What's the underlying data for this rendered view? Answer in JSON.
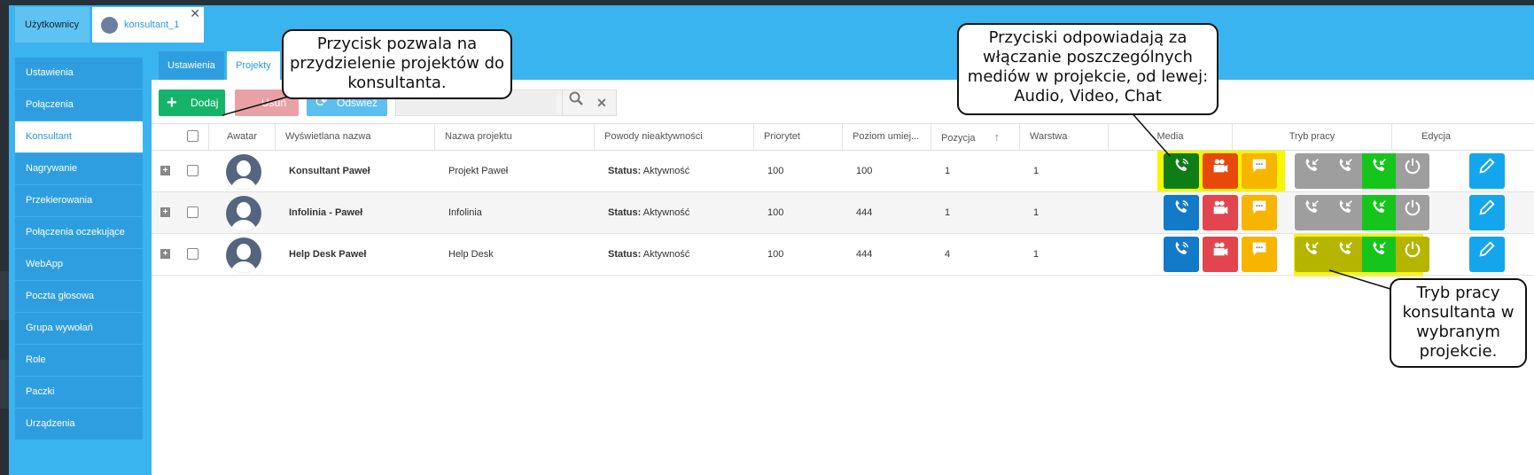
{
  "top_tabs": {
    "users": "Użytkownicy",
    "user": "konsultant_1",
    "close": "✕"
  },
  "sidebar": {
    "items": [
      {
        "label": "Ustawienia"
      },
      {
        "label": "Połączenia"
      },
      {
        "label": "Konsultant",
        "active": true
      },
      {
        "label": "Nagrywanie"
      },
      {
        "label": "Przekierowania"
      },
      {
        "label": "Połączenia oczekujące"
      },
      {
        "label": "WebApp"
      },
      {
        "label": "Poczta głosowa"
      },
      {
        "label": "Grupa wywołań"
      },
      {
        "label": "Role"
      },
      {
        "label": "Paczki"
      },
      {
        "label": "Urządzenia"
      }
    ]
  },
  "content_tabs": [
    "Ustawienia",
    "Projekty"
  ],
  "toolbar": {
    "add": "Dodaj",
    "delete": "Usuń",
    "refresh": "Odśwież",
    "search_placeholder": ""
  },
  "table": {
    "columns": [
      "Awatar",
      "Wyświetlana nazwa",
      "Nazwa projektu",
      "Powody nieaktywności",
      "Priorytet",
      "Poziom umiej...",
      "Pozycja",
      "Warstwa",
      "Media",
      "Tryb pracy",
      "Edycja"
    ],
    "sort_indicator": "↑",
    "rows": [
      {
        "name": "Konsultant Paweł",
        "project": "Projekt Paweł",
        "status_label": "Status:",
        "status": "Aktywność",
        "priority": "100",
        "skill": "100",
        "position": "1",
        "layer": "1"
      },
      {
        "name": "Infolinia - Paweł",
        "project": "Infolinia",
        "status_label": "Status:",
        "status": "Aktywność",
        "priority": "100",
        "skill": "444",
        "position": "1",
        "layer": "1"
      },
      {
        "name": "Help Desk Paweł",
        "project": "Help Desk",
        "status_label": "Status:",
        "status": "Aktywność",
        "priority": "100",
        "skill": "444",
        "position": "4",
        "layer": "1"
      }
    ]
  },
  "colors": {
    "accent": "#3ab4ef",
    "green": "#14b56b",
    "highlight": "#f6f600",
    "audio": "#1379c9",
    "video": "#e2454e",
    "chat": "#f7b500"
  },
  "callouts": {
    "add": "Przycisk pozwala na przydzielenie projektów do konsultanta.",
    "media": "Przyciski odpowiadają za włączanie poszczególnych mediów w projekcie, od lewej: Audio, Video, Chat",
    "mode": "Tryb pracy konsultanta w wybranym projekcie."
  }
}
